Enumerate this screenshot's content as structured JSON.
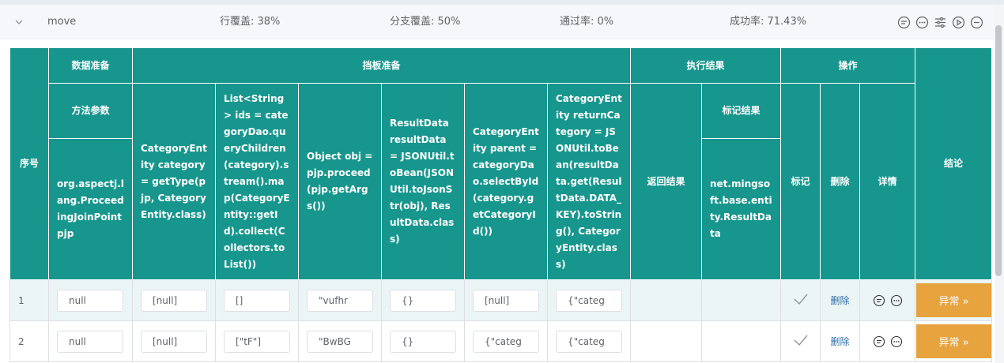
{
  "case": {
    "name": "move",
    "line_coverage": "行覆盖: 38%",
    "branch_coverage": "分支覆盖: 50%",
    "pass_rate": "通过率: 0%",
    "success_rate": "成功率: 71.43%"
  },
  "headers": {
    "index": "序号",
    "data_prep": "数据准备",
    "stub_prep": "挡板准备",
    "exec_result": "执行结果",
    "operation": "操作",
    "conclusion": "结论",
    "method_params": "方法参数",
    "param_type": "org.aspectj.lang.ProceedingJoinPoint pjp",
    "stubs": [
      "CategoryEntity category = getType(pjp, CategoryEntity.class)",
      "List<String> ids = categoryDao.queryChildren(category).stream().map(CategoryEntity::getId).collect(Collectors.toList())",
      "Object obj = pjp.proceed(pjp.getArgs())",
      "ResultData resultData = JSONUtil.toBean(JSONUtil.toJsonStr(obj), ResultData.class)",
      "CategoryEntity parent = categoryDao.selectById(category.getCategoryId())",
      "CategoryEntity returnCategory = JSONUtil.toBean(resultData.get(ResultData.DATA_KEY).toString(), CategoryEntity.class)"
    ],
    "return_result": "返回结果",
    "mark_result": "标记结果",
    "mark_type": "net.mingsoft.base.entity.ResultData",
    "mark": "标记",
    "delete": "删除",
    "detail": "详情"
  },
  "rows": [
    {
      "index": "1",
      "param": "null",
      "stubs": [
        "[null]",
        "[]",
        "\"vufhr",
        "{}",
        "[null]",
        "{\"categ"
      ],
      "delete_label": "删除",
      "result_label": "异常 »"
    },
    {
      "index": "2",
      "param": "null",
      "stubs": [
        "[null]",
        "[\"tF\"]",
        "\"BwBG",
        "{}",
        "{\"categ",
        "{\"categ"
      ],
      "delete_label": "删除",
      "result_label": "异常 »"
    }
  ],
  "icons": [
    "chevron-down-icon",
    "comment-icon",
    "chat-dots-icon",
    "settings-sliders-icon",
    "play-circle-icon",
    "minus-circle-icon",
    "check-icon"
  ],
  "colors": {
    "header_bg": "#17968e",
    "result_button": "#e7a33e",
    "row_highlight": "#ecf5f5"
  }
}
